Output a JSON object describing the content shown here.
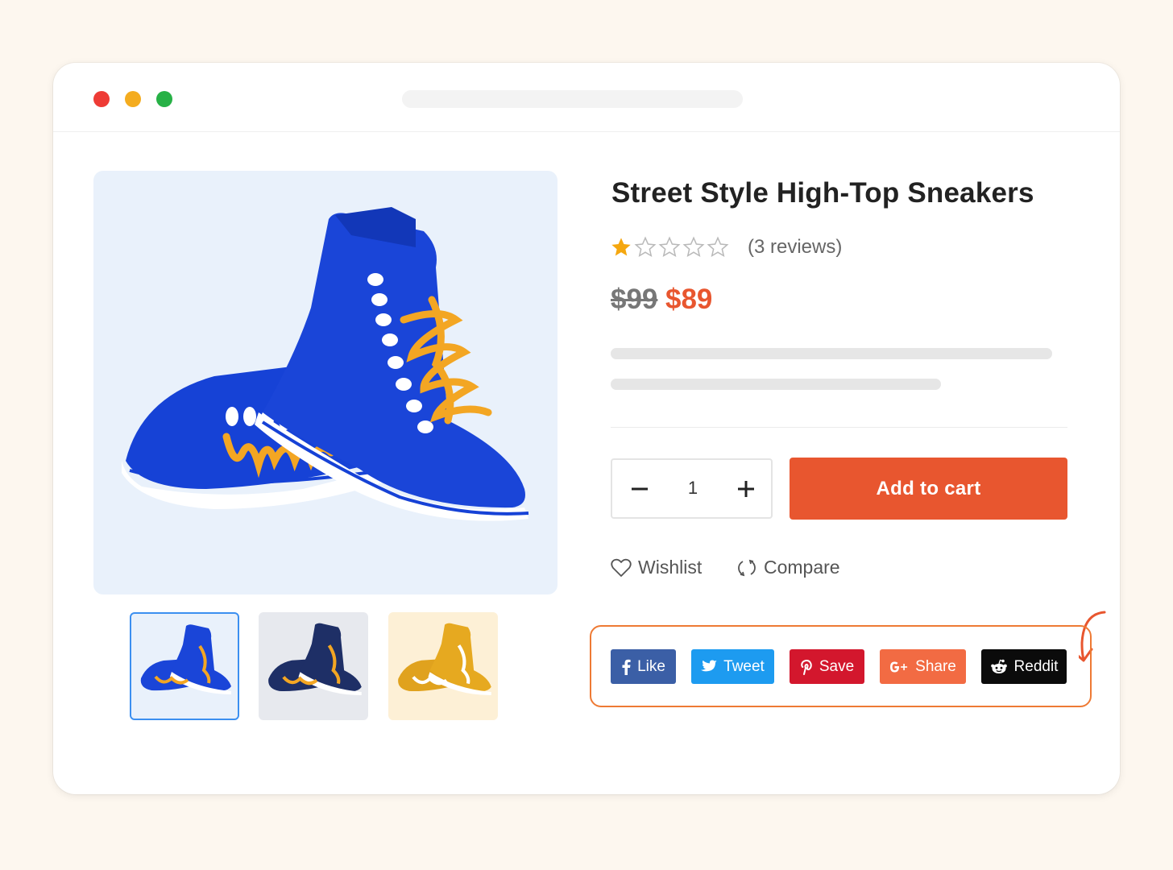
{
  "product": {
    "title": "Street Style High-Top Sneakers",
    "rating": 1,
    "rating_max": 5,
    "reviews_label": "(3 reviews)",
    "price_old": "$99",
    "price_new": "$89"
  },
  "cart": {
    "quantity": "1",
    "add_label": "Add to cart"
  },
  "actions": {
    "wishlist": "Wishlist",
    "compare": "Compare"
  },
  "share": {
    "facebook": "Like",
    "twitter": "Tweet",
    "pinterest": "Save",
    "google": "Share",
    "reddit": "Reddit"
  },
  "thumbnails": [
    {
      "color": "blue",
      "selected": true
    },
    {
      "color": "navy",
      "selected": false
    },
    {
      "color": "mustard",
      "selected": false
    }
  ],
  "colors": {
    "accent": "#e8562f",
    "facebook": "#3b5fa6",
    "twitter": "#1d9bf0",
    "pinterest": "#d3172d",
    "google": "#f26b43",
    "reddit": "#0b0b0b",
    "highlight": "#ee7a34"
  }
}
